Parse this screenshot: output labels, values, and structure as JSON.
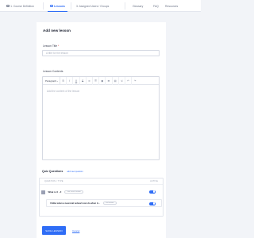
{
  "nav": {
    "tabs": [
      {
        "label": "1. Course Definition"
      },
      {
        "label": "Lessons"
      },
      {
        "label": "3. Assigned Users / Groups"
      },
      {
        "label": "Glossary"
      },
      {
        "label": "FAQ"
      },
      {
        "label": "Resources"
      }
    ],
    "active_index": 1
  },
  "form": {
    "title": "Add new lesson",
    "lesson_title_label": "Lesson Title",
    "required_mark": "*",
    "lesson_title_placeholder": "A title for the lesson",
    "lesson_title_value": "",
    "lesson_content_label": "Lesson Contents",
    "editor": {
      "paragraph_label": "Paragraph",
      "paragraph_chevron": "⌄",
      "toolbar_buttons": [
        {
          "glyph": "B",
          "name": "bold-icon"
        },
        {
          "glyph": "I",
          "name": "italic-icon"
        },
        {
          "glyph": "U",
          "name": "underline-icon"
        },
        {
          "glyph": "S",
          "name": "strikethrough-icon"
        },
        {
          "glyph": "≡",
          "name": "align-icon"
        },
        {
          "glyph": "☰",
          "name": "list-icon"
        },
        {
          "glyph": "▣",
          "name": "image-icon"
        },
        {
          "glyph": "⊞",
          "name": "table-icon"
        },
        {
          "glyph": "▤",
          "name": "media-icon"
        },
        {
          "glyph": "⇲",
          "name": "embed-icon"
        },
        {
          "glyph": "↶",
          "name": "undo-icon"
        },
        {
          "glyph": "↷",
          "name": "redo-icon"
        }
      ],
      "placeholder": "Add the content of the lesson"
    }
  },
  "quiz": {
    "title": "Quiz Questions",
    "add_link": "add new question",
    "col_question": "QUESTION / TYPE",
    "col_active": "ACTIVE",
    "question_1": "What is X - Z",
    "question_1_type": "one correct answer",
    "question_2": "Unlike when a neuronal network can do when it...",
    "question_2_type": "text answer"
  },
  "actions": {
    "save": "SAVE LESSON",
    "cancel": "Cancel"
  },
  "colors": {
    "accent": "#2f6df6",
    "background": "#f2f4f8"
  }
}
